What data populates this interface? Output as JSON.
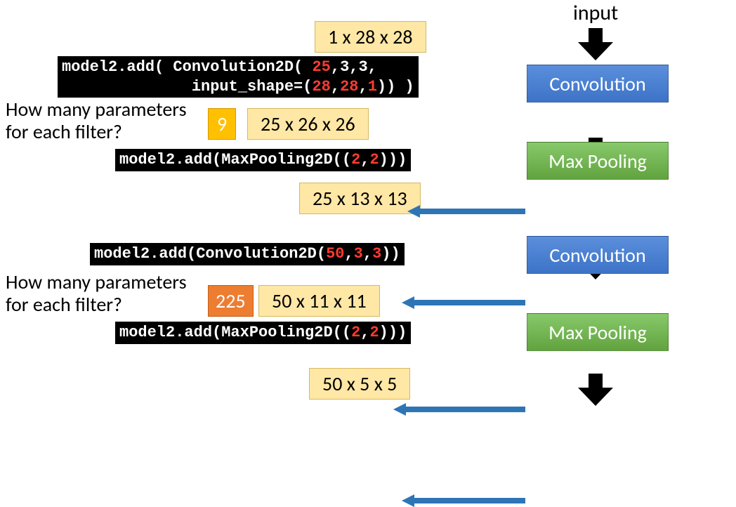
{
  "inputLabel": "input",
  "dims": {
    "d0": "1 x 28 x 28",
    "d1": "25 x 26 x 26",
    "d2": "25 x 13 x 13",
    "d3": "50 x 11 x 11",
    "d4": "50 x 5 x 5"
  },
  "flow": {
    "conv": "Convolution",
    "pool": "Max Pooling"
  },
  "q": "How many parameters\nfor each filter?",
  "counts": {
    "first": "9",
    "second": "225"
  },
  "code": {
    "c1a": "model2.add( Convolution2D( ",
    "c1b": "25",
    "c1c": ",3,3,",
    "c1d": "              input_shape=(",
    "c1e": "28",
    "c1f": ",",
    "c1g": "28",
    "c1h": ",",
    "c1i": "1",
    "c1j": ")) )",
    "c2a": "model2.add(MaxPooling2D((",
    "c2b": "2",
    "c2c": ",",
    "c2d": "2",
    "c2e": ")))",
    "c3a": "model2.add(Convolution2D(",
    "c3b": "50",
    "c3c": ",",
    "c3d": "3",
    "c3e": ",",
    "c3f": "3",
    "c3g": "))",
    "c4a": "model2.add(MaxPooling2D((",
    "c4b": "2",
    "c4c": ",",
    "c4d": "2",
    "c4e": ")))"
  }
}
